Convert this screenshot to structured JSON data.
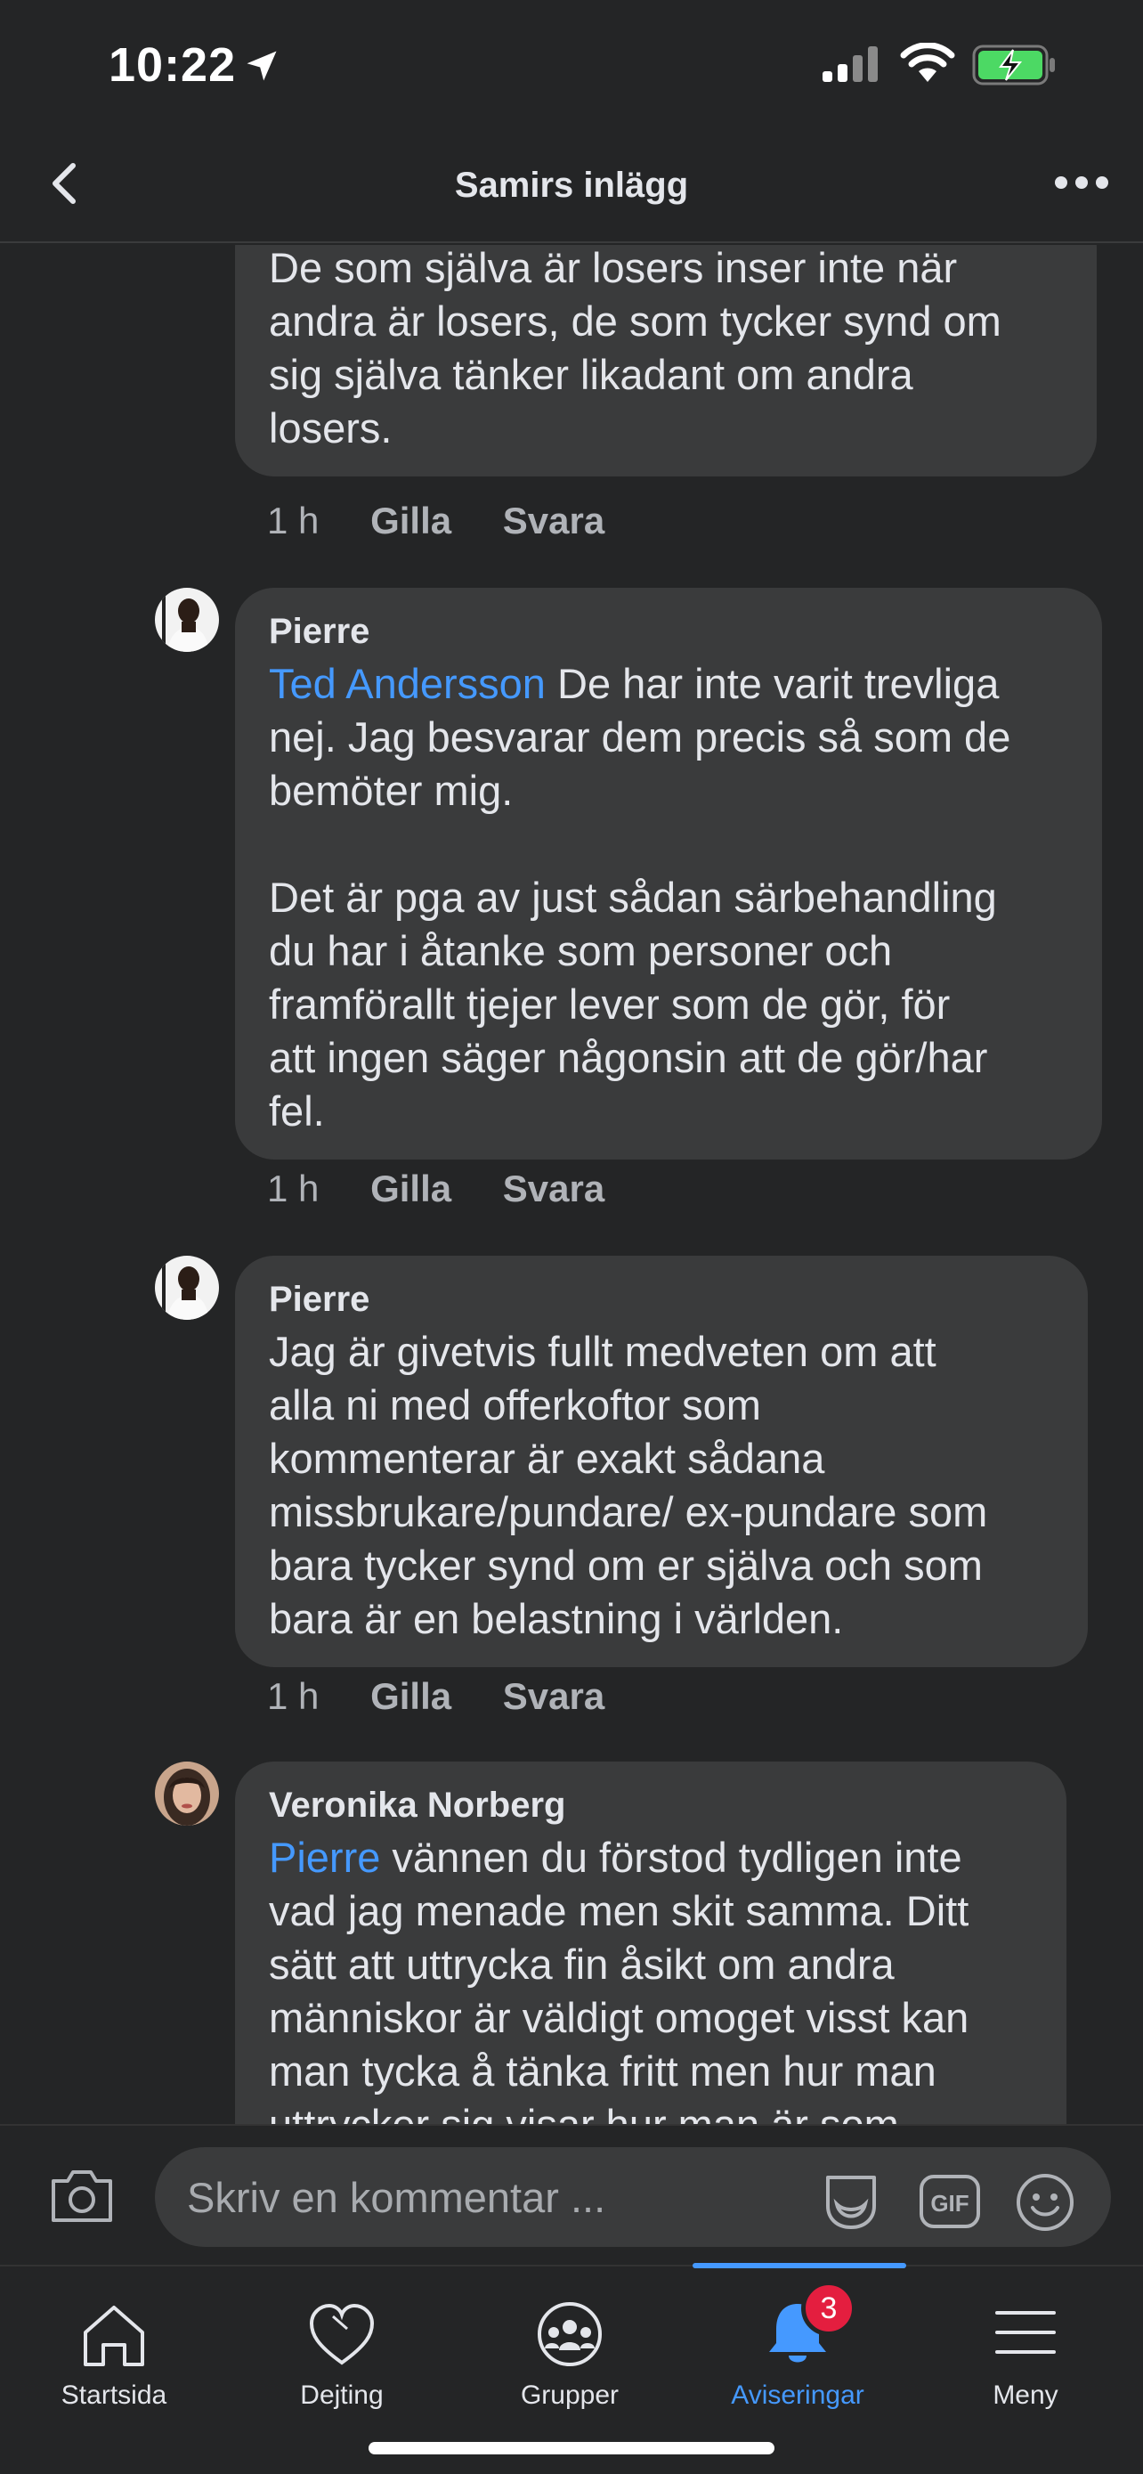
{
  "status": {
    "time": "10:22"
  },
  "header": {
    "title": "Samirs inlägg"
  },
  "comments": [
    {
      "author": "",
      "text": "De som själva är losers inser inte när\nandra är losers, de som tycker synd om\nsig själva tänker likadant om andra\nlosers.",
      "age": "1 h",
      "like": "Gilla",
      "reply": "Svara"
    },
    {
      "author": "Pierre",
      "mention": "Ted Andersson",
      "text": " De har inte varit trevliga\nnej. Jag besvarar dem precis så som de\nbemöter mig.\n\nDet är pga av just sådan särbehandling\ndu har i åtanke som personer och\nframförallt tjejer lever som de gör, för\natt ingen säger någonsin att de gör/har\nfel.",
      "age": "1 h",
      "like": "Gilla",
      "reply": "Svara"
    },
    {
      "author": "Pierre",
      "text": "Jag är givetvis fullt medveten om att\nalla ni med offerkoftor som\nkommenterar är exakt sådana\nmissbrukare/pundare/ ex-pundare som\nbara tycker synd om er själva och som\nbara är en belastning i världen.",
      "age": "1 h",
      "like": "Gilla",
      "reply": "Svara"
    },
    {
      "author": "Veronika Norberg",
      "mention": "Pierre",
      "text": " vännen du förstod tydligen inte\nvad jag menade men skit samma. Ditt\nsätt att uttrycka fin åsikt om andra\nmänniskor är väldigt omoget visst kan\nman tycka å tänka fritt men hur man\nuttrycker sig visar hur man är som"
    }
  ],
  "composer": {
    "placeholder": "Skriv en kommentar ..."
  },
  "tabs": [
    {
      "label": "Startsida",
      "icon": "home-icon"
    },
    {
      "label": "Dejting",
      "icon": "heart-icon"
    },
    {
      "label": "Grupper",
      "icon": "groups-icon"
    },
    {
      "label": "Aviseringar",
      "icon": "bell-icon",
      "active": true,
      "badge": "3"
    },
    {
      "label": "Meny",
      "icon": "menu-icon"
    }
  ],
  "colors": {
    "background": "#242526",
    "bubble": "#3a3b3c",
    "accent": "#4599ff",
    "badge": "#e41e3f"
  }
}
